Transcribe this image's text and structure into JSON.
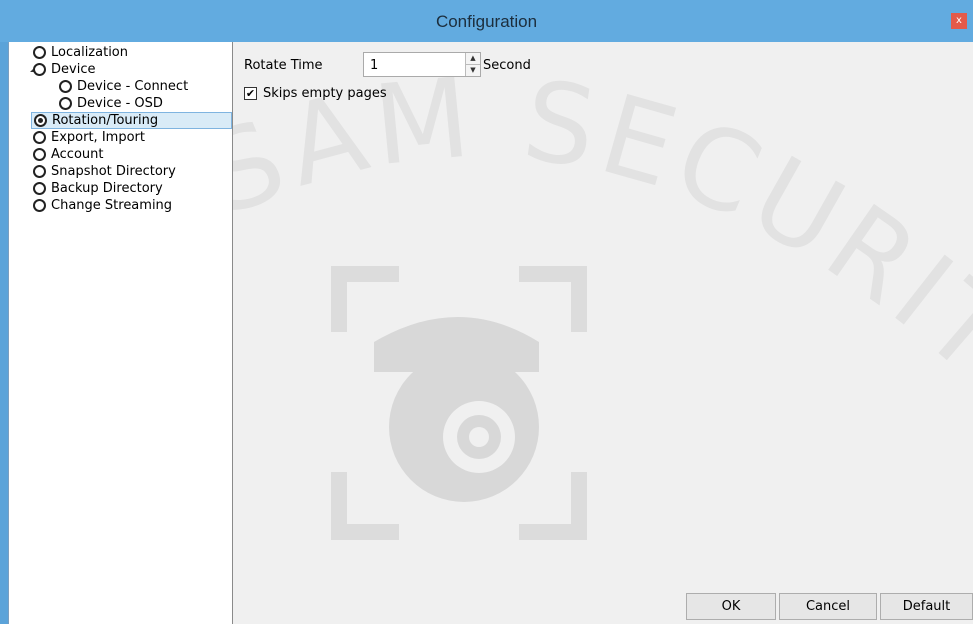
{
  "window": {
    "title": "Configuration",
    "close_glyph": "x"
  },
  "tree": {
    "items": [
      {
        "label": "Localization",
        "checked": false
      },
      {
        "label": "Device",
        "checked": false,
        "expander": "◢"
      },
      {
        "label": "Device - Connect",
        "checked": false
      },
      {
        "label": "Device - OSD",
        "checked": false
      },
      {
        "label": "Rotation/Touring",
        "checked": true
      },
      {
        "label": "Export, Import",
        "checked": false
      },
      {
        "label": "Account",
        "checked": false
      },
      {
        "label": "Snapshot Directory",
        "checked": false
      },
      {
        "label": "Backup Directory",
        "checked": false
      },
      {
        "label": "Change Streaming",
        "checked": false
      }
    ]
  },
  "rotation": {
    "rotate_time_label": "Rotate Time",
    "rotate_time_value": "1",
    "unit": "Second",
    "skip_label": "Skips empty pages",
    "skip_checked": true
  },
  "buttons": {
    "ok": "OK",
    "cancel": "Cancel",
    "default": "Default"
  },
  "watermark": {
    "text": "OLLSAM SECURITY"
  },
  "colors": {
    "titlebar": "#62abe0",
    "close": "#e45a4a",
    "selection": "#d9ebf7"
  }
}
